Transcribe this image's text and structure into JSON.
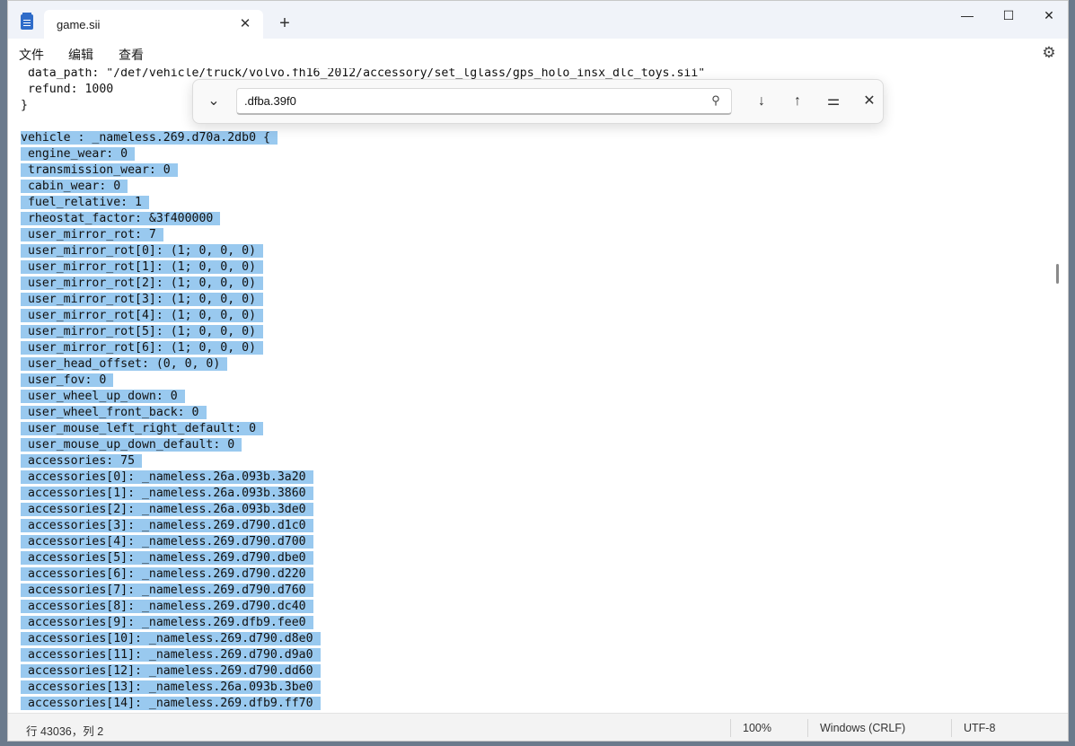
{
  "tab": {
    "title": "game.sii",
    "close_glyph": "✕",
    "new_glyph": "+"
  },
  "window_controls": {
    "minimize": "—",
    "maximize": "☐",
    "close": "✕"
  },
  "menu": {
    "file": "文件",
    "edit": "编辑",
    "view": "查看"
  },
  "icons": {
    "settings": "gear-icon",
    "search": "search-icon"
  },
  "find": {
    "value": ".dfba.39f0",
    "toggle_glyph": "⌄",
    "search_glyph": "⚲",
    "next_glyph": "↓",
    "prev_glyph": "↑",
    "options_glyph": "⚌",
    "close_glyph": "✕"
  },
  "editor": {
    "selection_color": "#99c9ef",
    "pre_lines": [
      " data_path: \"/def/vehicle/truck/volvo.fh16_2012/accessory/set_lglass/gps_holo_insx_dlc_toys.sii\"",
      " refund: 1000",
      "}",
      ""
    ],
    "selected_lines": [
      "vehicle : _nameless.269.d70a.2db0 {",
      " engine_wear: 0",
      " transmission_wear: 0",
      " cabin_wear: 0",
      " fuel_relative: 1",
      " rheostat_factor: &3f400000",
      " user_mirror_rot: 7",
      " user_mirror_rot[0]: (1; 0, 0, 0)",
      " user_mirror_rot[1]: (1; 0, 0, 0)",
      " user_mirror_rot[2]: (1; 0, 0, 0)",
      " user_mirror_rot[3]: (1; 0, 0, 0)",
      " user_mirror_rot[4]: (1; 0, 0, 0)",
      " user_mirror_rot[5]: (1; 0, 0, 0)",
      " user_mirror_rot[6]: (1; 0, 0, 0)",
      " user_head_offset: (0, 0, 0)",
      " user_fov: 0",
      " user_wheel_up_down: 0",
      " user_wheel_front_back: 0",
      " user_mouse_left_right_default: 0",
      " user_mouse_up_down_default: 0",
      " accessories: 75",
      " accessories[0]: _nameless.26a.093b.3a20",
      " accessories[1]: _nameless.26a.093b.3860",
      " accessories[2]: _nameless.26a.093b.3de0",
      " accessories[3]: _nameless.269.d790.d1c0",
      " accessories[4]: _nameless.269.d790.d700",
      " accessories[5]: _nameless.269.d790.dbe0",
      " accessories[6]: _nameless.269.d790.d220",
      " accessories[7]: _nameless.269.d790.d760",
      " accessories[8]: _nameless.269.d790.dc40",
      " accessories[9]: _nameless.269.dfb9.fee0",
      " accessories[10]: _nameless.269.d790.d8e0",
      " accessories[11]: _nameless.269.d790.d9a0",
      " accessories[12]: _nameless.269.d790.dd60",
      " accessories[13]: _nameless.26a.093b.3be0",
      " accessories[14]: _nameless.269.dfb9.ff70"
    ]
  },
  "status": {
    "position": "行 43036，列 2",
    "zoom": "100%",
    "line_ending": "Windows (CRLF)",
    "encoding": "UTF-8"
  }
}
